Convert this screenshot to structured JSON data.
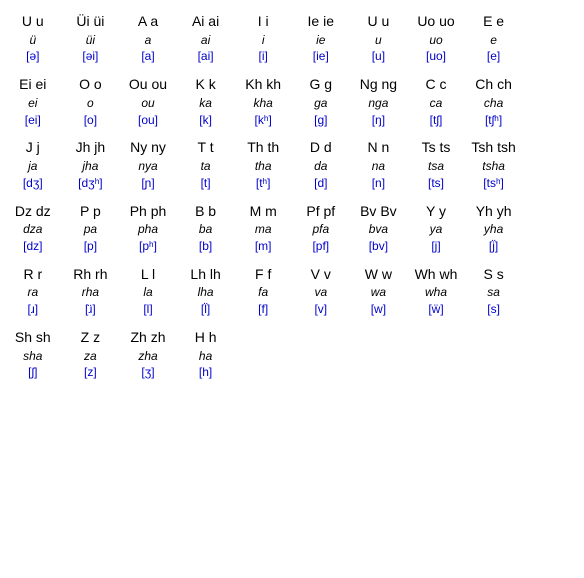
{
  "entries": [
    {
      "letter": "U u",
      "example": "ü",
      "ipa": "[ə]"
    },
    {
      "letter": "Üi üi",
      "example": "üi",
      "ipa": "[əi]"
    },
    {
      "letter": "A a",
      "example": "a",
      "ipa": "[a]"
    },
    {
      "letter": "Ai ai",
      "example": "ai",
      "ipa": "[ai]"
    },
    {
      "letter": "I i",
      "example": "i",
      "ipa": "[i]"
    },
    {
      "letter": "Ie ie",
      "example": "ie",
      "ipa": "[ie]"
    },
    {
      "letter": "U u",
      "example": "u",
      "ipa": "[u]"
    },
    {
      "letter": "Uo uo",
      "example": "uo",
      "ipa": "[uo]"
    },
    {
      "letter": "E e",
      "example": "e",
      "ipa": "[e]"
    },
    {
      "letter": "",
      "example": "",
      "ipa": ""
    },
    {
      "letter": "Ei ei",
      "example": "ei",
      "ipa": "[ei]"
    },
    {
      "letter": "O o",
      "example": "o",
      "ipa": "[o]"
    },
    {
      "letter": "Ou ou",
      "example": "ou",
      "ipa": "[ou]"
    },
    {
      "letter": "K k",
      "example": "ka",
      "ipa": "[k]"
    },
    {
      "letter": "Kh kh",
      "example": "kha",
      "ipa": "[kʰ]"
    },
    {
      "letter": "G g",
      "example": "ga",
      "ipa": "[g]"
    },
    {
      "letter": "Ng ng",
      "example": "nga",
      "ipa": "[ŋ]"
    },
    {
      "letter": "C c",
      "example": "ca",
      "ipa": "[tʃ]"
    },
    {
      "letter": "Ch ch",
      "example": "cha",
      "ipa": "[tʃʰ]"
    },
    {
      "letter": "",
      "example": "",
      "ipa": ""
    },
    {
      "letter": "J j",
      "example": "ja",
      "ipa": "[dʒ]"
    },
    {
      "letter": "Jh jh",
      "example": "jha",
      "ipa": "[dʒʰ]"
    },
    {
      "letter": "Ny ny",
      "example": "nya",
      "ipa": "[ɲ]"
    },
    {
      "letter": "T t",
      "example": "ta",
      "ipa": "[t]"
    },
    {
      "letter": "Th th",
      "example": "tha",
      "ipa": "[tʰ]"
    },
    {
      "letter": "D d",
      "example": "da",
      "ipa": "[d]"
    },
    {
      "letter": "N n",
      "example": "na",
      "ipa": "[n]"
    },
    {
      "letter": "Ts ts",
      "example": "tsa",
      "ipa": "[ts]"
    },
    {
      "letter": "Tsh tsh",
      "example": "tsha",
      "ipa": "[tsʰ]"
    },
    {
      "letter": "",
      "example": "",
      "ipa": ""
    },
    {
      "letter": "Dz dz",
      "example": "dza",
      "ipa": "[dz]"
    },
    {
      "letter": "P p",
      "example": "pa",
      "ipa": "[p]"
    },
    {
      "letter": "Ph ph",
      "example": "pha",
      "ipa": "[pʰ]"
    },
    {
      "letter": "B b",
      "example": "ba",
      "ipa": "[b]"
    },
    {
      "letter": "M m",
      "example": "ma",
      "ipa": "[m]"
    },
    {
      "letter": "Pf pf",
      "example": "pfa",
      "ipa": "[pf]"
    },
    {
      "letter": "Bv Bv",
      "example": "bva",
      "ipa": "[bv]"
    },
    {
      "letter": "Y y",
      "example": "ya",
      "ipa": "[j]"
    },
    {
      "letter": "Yh yh",
      "example": "yha",
      "ipa": "[j̈]"
    },
    {
      "letter": "",
      "example": "",
      "ipa": ""
    },
    {
      "letter": "R r",
      "example": "ra",
      "ipa": "[ɹ]"
    },
    {
      "letter": "Rh rh",
      "example": "rha",
      "ipa": "[ɹ̈]"
    },
    {
      "letter": "L l",
      "example": "la",
      "ipa": "[l]"
    },
    {
      "letter": "Lh lh",
      "example": "lha",
      "ipa": "[l̈]"
    },
    {
      "letter": "F f",
      "example": "fa",
      "ipa": "[f]"
    },
    {
      "letter": "V v",
      "example": "va",
      "ipa": "[v]"
    },
    {
      "letter": "W w",
      "example": "wa",
      "ipa": "[w]"
    },
    {
      "letter": "Wh wh",
      "example": "wha",
      "ipa": "[ẅ]"
    },
    {
      "letter": "S s",
      "example": "sa",
      "ipa": "[s]"
    },
    {
      "letter": "",
      "example": "",
      "ipa": ""
    },
    {
      "letter": "Sh sh",
      "example": "sha",
      "ipa": "[ʃ]"
    },
    {
      "letter": "Z z",
      "example": "za",
      "ipa": "[z]"
    },
    {
      "letter": "Zh zh",
      "example": "zha",
      "ipa": "[ʒ]"
    },
    {
      "letter": "H h",
      "example": "ha",
      "ipa": "[h]"
    },
    {
      "letter": "",
      "example": "",
      "ipa": ""
    },
    {
      "letter": "",
      "example": "",
      "ipa": ""
    },
    {
      "letter": "",
      "example": "",
      "ipa": ""
    },
    {
      "letter": "",
      "example": "",
      "ipa": ""
    },
    {
      "letter": "",
      "example": "",
      "ipa": ""
    },
    {
      "letter": "",
      "example": "",
      "ipa": ""
    }
  ]
}
